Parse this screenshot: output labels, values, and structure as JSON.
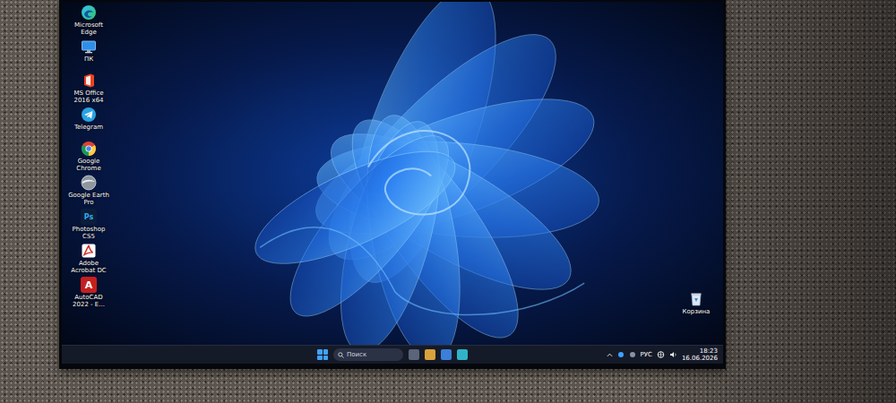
{
  "desktop": {
    "icons": [
      {
        "label": "Microsoft Edge",
        "kind": "edge"
      },
      {
        "label": "ПК",
        "kind": "pc"
      },
      {
        "label": "MS Office 2016 x64",
        "kind": "office"
      },
      {
        "label": "Telegram",
        "kind": "telegram"
      },
      {
        "label": "Google Chrome",
        "kind": "chrome"
      },
      {
        "label": "Google Earth Pro",
        "kind": "earth"
      },
      {
        "label": "Photoshop CS5",
        "kind": "photoshop",
        "glyph": "Ps"
      },
      {
        "label": "Adobe Acrobat DC",
        "kind": "acrobat"
      },
      {
        "label": "AutoCAD 2022 - E...",
        "kind": "autocad",
        "glyph": "A"
      }
    ],
    "recycle_bin": {
      "label": "Корзина"
    }
  },
  "taskbar": {
    "search": {
      "placeholder": "Поиск"
    },
    "tray": {
      "language": "РУС",
      "time": "18:23",
      "date": "16.06.2026"
    }
  }
}
